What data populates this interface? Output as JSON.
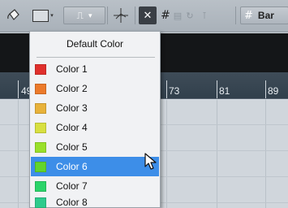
{
  "toolbar": {
    "icons": [
      "paint-bucket-icon",
      "color-swatch-icon",
      "quantize-icon",
      "crosshair-icon",
      "snap-icon",
      "grid-icon"
    ],
    "grid_label": "Bar"
  },
  "ruler": {
    "ticks": [
      "49",
      "73",
      "81",
      "89"
    ]
  },
  "menu": {
    "header": "Default Color",
    "items": [
      {
        "label": "Color 1",
        "color": "#e0302c"
      },
      {
        "label": "Color 2",
        "color": "#ec7a2a"
      },
      {
        "label": "Color 3",
        "color": "#e8b23a"
      },
      {
        "label": "Color 4",
        "color": "#d8e040"
      },
      {
        "label": "Color 5",
        "color": "#9ae02a"
      },
      {
        "label": "Color 6",
        "color": "#62d52c"
      },
      {
        "label": "Color 7",
        "color": "#2bd46a"
      },
      {
        "label": "Color 8",
        "color": "#2ecb8c"
      }
    ],
    "selected": "Color 6"
  }
}
